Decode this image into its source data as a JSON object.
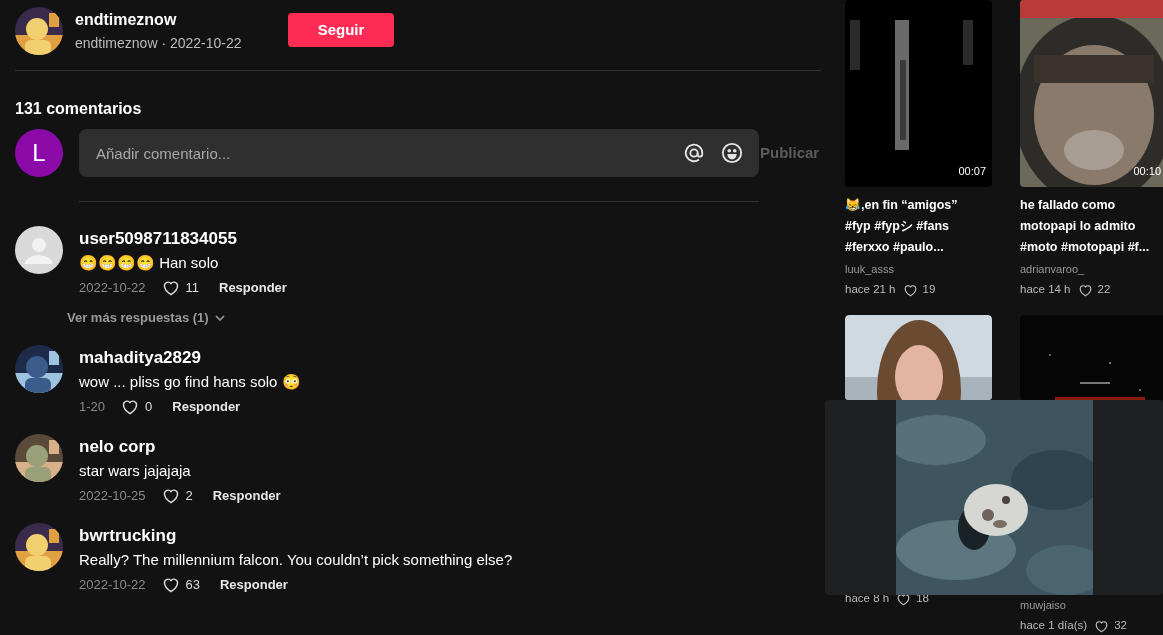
{
  "post": {
    "author": "endtimeznow",
    "subtitle": "endtimeznow · 2022-10-22",
    "follow_button": "Seguir"
  },
  "comment_count": "131 comentarios",
  "composer": {
    "avatar_letter": "L",
    "placeholder": "Añadir comentario...",
    "submit": "Publicar"
  },
  "comments": [
    {
      "kind": "default",
      "user": "user5098711834055",
      "text": "😁😁😁😁 Han solo",
      "date": "2022-10-22",
      "likes": "11",
      "reply": "Responder",
      "more_replies": "Ver más respuestas (1)"
    },
    {
      "kind": "picture",
      "user": "mahaditya2829",
      "text": "wow ... pliss go find hans solo 😳",
      "date": "1-20",
      "likes": "0",
      "reply": "Responder"
    },
    {
      "kind": "picture",
      "user": "nelo corp",
      "text": "star wars jajajaja",
      "date": "2022-10-25",
      "likes": "2",
      "reply": "Responder"
    },
    {
      "kind": "picture",
      "user": "bwrtrucking",
      "text": "Really? The millennium falcon. You couldn’t pick something else?",
      "date": "2022-10-22",
      "likes": "63",
      "reply": "Responder"
    }
  ],
  "videos": [
    {
      "duration": "00:07",
      "caption": "😹,en fin “amigos”\n#fyp #fypシ #fans\n#ferxxo #paulo...",
      "author": "luuk_asss",
      "age": "hace 21 h",
      "likes": "19"
    },
    {
      "duration": "00:10",
      "caption": "he fallado como\nmotopapi lo admito\n#moto #motopapi #f...",
      "author": "adrianvaroo_",
      "age": "hace 14 h",
      "likes": "22"
    },
    {
      "age": "hace 8 h",
      "likes": "18"
    },
    {
      "author": "muwjaiso",
      "age": "hace 1 día(s)",
      "likes": "32"
    }
  ]
}
